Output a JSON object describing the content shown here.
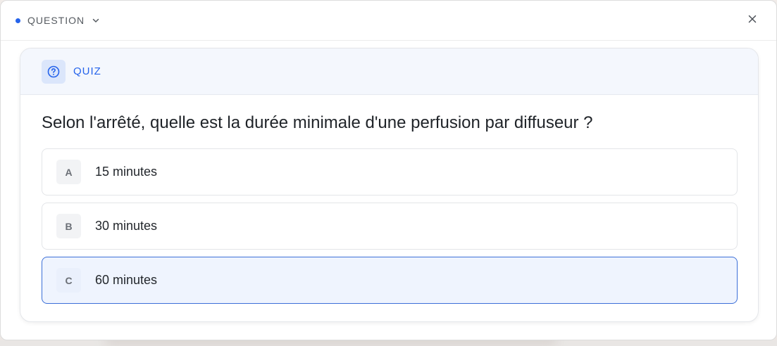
{
  "header": {
    "tag_label": "QUESTION",
    "tag_dot_color": "#2563eb",
    "tag_icon": "chevron-down-icon",
    "close_icon": "close-icon"
  },
  "quiz": {
    "section_label": "QUIZ",
    "section_icon": "question-circle-icon",
    "accent_color": "#2563eb",
    "question": "Selon l'arrêté, quelle est la durée minimale d'une perfusion par diffuseur ?",
    "options": [
      {
        "letter": "A",
        "text": "15 minutes",
        "selected": false
      },
      {
        "letter": "B",
        "text": "30 minutes",
        "selected": false
      },
      {
        "letter": "C",
        "text": "60 minutes",
        "selected": true
      }
    ]
  }
}
